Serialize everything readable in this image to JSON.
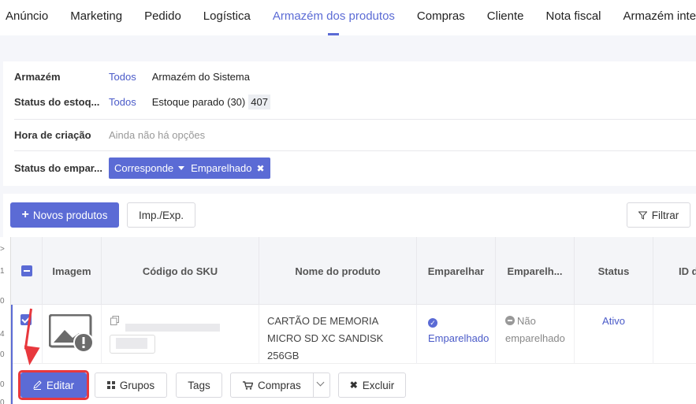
{
  "nav": {
    "items": [
      "Anúncio",
      "Marketing",
      "Pedido",
      "Logística",
      "Armazém dos produtos",
      "Compras",
      "Cliente",
      "Nota fiscal",
      "Armazém internacio"
    ],
    "active_index": 4
  },
  "filters": {
    "warehouse": {
      "label": "Armazém",
      "all": "Todos",
      "option": "Armazém do Sistema"
    },
    "stock_status": {
      "label": "Status do estoq...",
      "all": "Todos",
      "option": "Estoque parado (30)",
      "count": "407"
    },
    "created": {
      "label": "Hora de criação",
      "empty": "Ainda não há opções"
    },
    "pair_status": {
      "label": "Status do empar...",
      "selector": "Corresponde",
      "value": "Emparelhado"
    }
  },
  "toolbar": {
    "new_products": "Novos produtos",
    "import_export": "Imp./Exp.",
    "filter": "Filtrar"
  },
  "table": {
    "headers": {
      "image": "Imagem",
      "sku": "Código do SKU",
      "name": "Nome do produto",
      "pair": "Emparelhar",
      "paired": "Emparelh...",
      "status": "Status",
      "id": "ID d"
    },
    "row": {
      "name": "CARTÃO DE MEMORIA MICRO SD XC SANDISK 256GB",
      "pair": "Emparelhado",
      "paired": "Não emparelhado",
      "status": "Ativo"
    }
  },
  "row_actions": {
    "edit": "Editar",
    "groups": "Grupos",
    "tags": "Tags",
    "purchases": "Compras",
    "delete": "Excluir"
  },
  "left_edge_marks": [
    ">",
    "1",
    "0",
    "4",
    "0",
    "0",
    "0"
  ],
  "colors": {
    "accent": "#5b6bd5",
    "annotation": "#e8383d"
  }
}
